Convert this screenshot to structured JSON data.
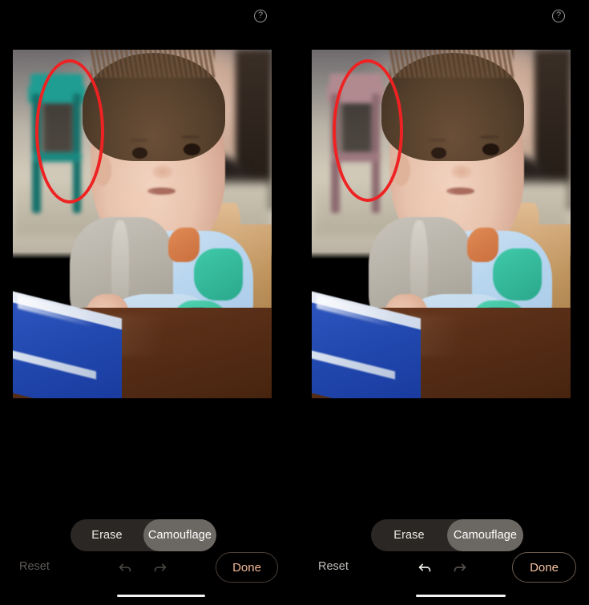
{
  "app": {
    "feature_name": "Camouflage",
    "background_color": "#000000"
  },
  "panels": [
    {
      "id": "before",
      "help_icon": "help-circle-icon",
      "photo": {
        "description": "Blurred indoor scene: baby in wooden high chair with grey bib, light blue dinosaur shirt, blue plastic tray on dark brown table",
        "highlighted_object": "teal stool",
        "stool_color": "#1f9d92",
        "stool_shadow_color": "#15706a",
        "annotation": {
          "shape": "ellipse",
          "color": "#ee2222",
          "label": "selection-highlight"
        }
      },
      "mode_toggle": {
        "options": [
          "Erase",
          "Camouflage"
        ],
        "selected": "Camouflage"
      },
      "controls": {
        "reset_label": "Reset",
        "reset_enabled": false,
        "undo_icon": "undo-arrow-icon",
        "undo_enabled": false,
        "redo_icon": "redo-arrow-icon",
        "redo_enabled": false,
        "done_label": "Done"
      }
    },
    {
      "id": "after",
      "help_icon": "help-circle-icon",
      "photo": {
        "description": "Same scene after Camouflage applied: the teal stool is recolored to muted mauve-pink to blend with surroundings",
        "highlighted_object": "camouflaged stool",
        "stool_color": "#b08a8f",
        "stool_shadow_color": "#8c6a70",
        "annotation": {
          "shape": "ellipse",
          "color": "#ee2222",
          "label": "selection-highlight"
        }
      },
      "mode_toggle": {
        "options": [
          "Erase",
          "Camouflage"
        ],
        "selected": "Camouflage"
      },
      "controls": {
        "reset_label": "Reset",
        "reset_enabled": true,
        "undo_icon": "undo-arrow-icon",
        "undo_enabled": true,
        "redo_icon": "redo-arrow-icon",
        "redo_enabled": false,
        "done_label": "Done"
      }
    }
  ],
  "colors": {
    "accent_done": "#f2b894",
    "toggle_bg": "#2b2724",
    "toggle_active_bg": "#6b6762",
    "annotation_red": "#ee2222",
    "reset_disabled": "#5e5a56",
    "reset_enabled": "#c3bfba"
  }
}
